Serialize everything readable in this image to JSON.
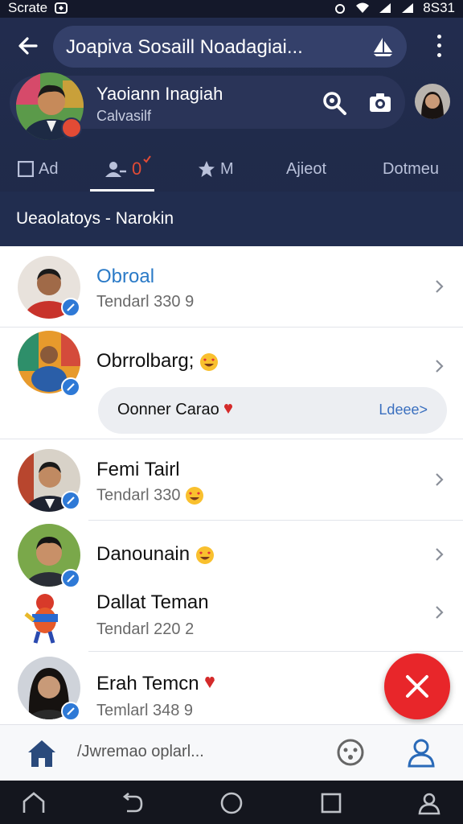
{
  "status_bar": {
    "carrier": "Scrate",
    "time": "8S31"
  },
  "topbar": {
    "title": "Joapiva Sosaill Noadagiai..."
  },
  "profile": {
    "name": "Yaoiann Inagiah",
    "subtitle": "Calvasilf"
  },
  "tabs": [
    {
      "label": "Ad",
      "icon": "checkbox-icon"
    },
    {
      "label": "",
      "icon": "user-add-icon",
      "badge": "0",
      "active": true
    },
    {
      "label": "M",
      "icon": "star-icon"
    },
    {
      "label": "Ajieot"
    },
    {
      "label": "Dotmeu"
    }
  ],
  "banner": {
    "text": "Ueaolatoys  -  Narokin"
  },
  "contacts": [
    {
      "name": "Obroal",
      "subtitle": "Tendarl 330 9"
    },
    {
      "name": "Obrrolbarg;",
      "bubble_text": "Oonner Carao",
      "bubble_more": "Ldeee>"
    },
    {
      "name": "Femi Tairl",
      "subtitle": "Tendarl 330"
    },
    {
      "name": "Danounain"
    },
    {
      "name": "Dallat Teman",
      "subtitle": "Tendarl 220 2"
    },
    {
      "name": "Erah Temcn",
      "subtitle": "Temlarl 348 9"
    }
  ],
  "bottom_bar": {
    "input_placeholder": "/Jwremao oplarl..."
  },
  "colors": {
    "header": "#222c4e",
    "accent_blue": "#2a7ac7",
    "fab": "#e8262a",
    "badge_blue": "#2e79d6"
  },
  "icons": [
    "back-arrow-icon",
    "sail-icon",
    "more-vert-icon",
    "search-icon",
    "camera-icon",
    "home-icon",
    "emoji-icon",
    "user-icon",
    "close-icon",
    "chevron-right-icon"
  ]
}
